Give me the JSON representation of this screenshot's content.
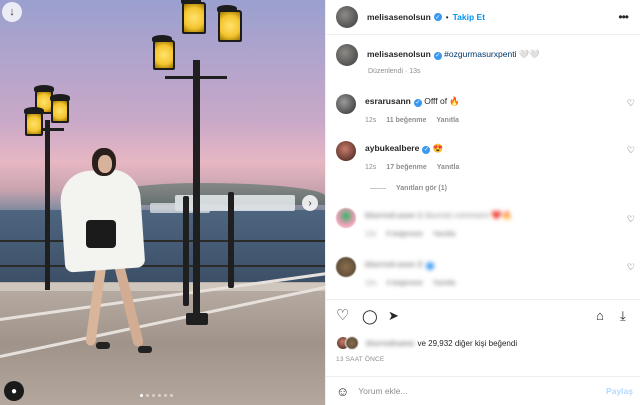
{
  "header": {
    "username": "melisasenolsun",
    "separator": "•",
    "follow_label": "Takip Et",
    "more_icon": "more-horizontal-icon"
  },
  "caption": {
    "username": "melisasenolsun",
    "hashtag": "#ozgurmasurxpenti",
    "emojis": "🤍🤍",
    "edited": "Düzenlendi · 13s"
  },
  "comments": [
    {
      "username": "esrarusann",
      "verified": true,
      "text": "Offf of 🔥",
      "time": "12s",
      "likes": "11 beğenme",
      "reply": "Yanıtla"
    },
    {
      "username": "aybukealbere",
      "verified": true,
      "text": "😍",
      "time": "12s",
      "likes": "17 beğenme",
      "reply": "Yanıtla"
    },
    {
      "username": "blurred-user-1",
      "verified": false,
      "text": "blurred comment ❤️🔥",
      "time": "12s",
      "likes": "5 beğenme",
      "reply": "Yanıtla"
    },
    {
      "username": "blurred-user-2",
      "verified": true,
      "text": "",
      "time": "12s",
      "likes": "4 beğenme",
      "reply": "Yanıtla"
    }
  ],
  "view_replies": "Yanıtları gör (1)",
  "likes": {
    "prefix_blurred": "blurredname",
    "text": "ve 29,932 diğer kişi beğendi"
  },
  "time": "13 SAAT ÖNCE",
  "add_comment": {
    "placeholder": "Yorum ekle...",
    "post_label": "Paylaş"
  },
  "colors": {
    "accent": "#0095f6",
    "muted": "#8e8e8e",
    "verified": "#3897f0"
  }
}
